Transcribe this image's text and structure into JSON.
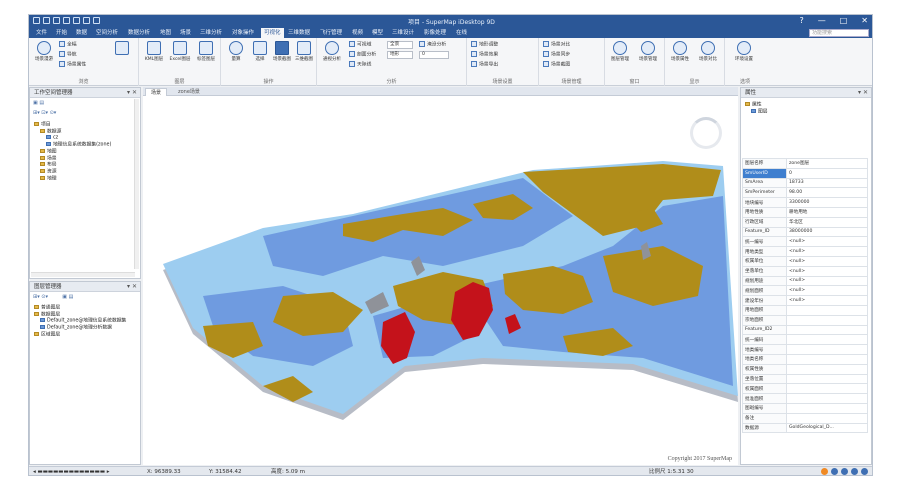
{
  "app": {
    "title": "项目 - SuperMap iDesktop 9D",
    "window_controls": [
      "?",
      "—",
      "□",
      "✕"
    ]
  },
  "menu": {
    "tabs": [
      "文件",
      "开始",
      "数据",
      "空间分析",
      "数据分析",
      "地图",
      "场景",
      "三维分析",
      "对象操作",
      "可视化",
      "三维数据",
      "飞行管理",
      "视频",
      "模型",
      "三维设计",
      "影像处理",
      "在线"
    ],
    "active_index": 9,
    "search_placeholder": "功能搜索"
  },
  "ribbon": {
    "groups": [
      {
        "label": "浏览",
        "buttons": [
          "场景漫游",
          "全幅",
          "导航",
          "场景属性"
        ]
      },
      {
        "label": "图层",
        "buttons": [
          "KML图层",
          "Excel图层",
          "标签图层",
          "专题图层"
        ]
      },
      {
        "label": "操作",
        "buttons": [
          "量算",
          "选择",
          "场景截图",
          "三维截图"
        ]
      },
      {
        "label": "分析",
        "buttons": [
          "通视分析",
          "可视域",
          "剖面分析",
          "天际线",
          "淹没分析"
        ]
      },
      {
        "label": "场景设置",
        "small": [
          "地形调整",
          "场景效果",
          "场景导出"
        ]
      },
      {
        "label": "场景管理",
        "small": [
          "场景对比",
          "场景同步",
          "场景截图"
        ]
      },
      {
        "label": "窗口",
        "buttons": [
          "图层管理",
          "场景管理"
        ]
      },
      {
        "label": "显示",
        "buttons": [
          "场景属性",
          "场景对比"
        ]
      },
      {
        "label": "选项",
        "buttons": [
          "环境设置"
        ]
      }
    ],
    "selects": [
      "全景",
      "地形",
      "0"
    ]
  },
  "workspace_panel": {
    "title": "工作空间管理器",
    "tree": [
      {
        "level": 0,
        "label": "项目",
        "kind": "folder"
      },
      {
        "level": 1,
        "label": "数据源",
        "kind": "folder"
      },
      {
        "level": 2,
        "label": "cz",
        "kind": "layer"
      },
      {
        "level": 2,
        "label": "地理信息系统数据集(zone)",
        "kind": "layer"
      },
      {
        "level": 1,
        "label": "地图",
        "kind": "folder"
      },
      {
        "level": 1,
        "label": "场景",
        "kind": "folder"
      },
      {
        "level": 1,
        "label": "布局",
        "kind": "folder"
      },
      {
        "level": 1,
        "label": "资源",
        "kind": "folder"
      },
      {
        "level": 1,
        "label": "地理",
        "kind": "folder"
      }
    ]
  },
  "layer_panel": {
    "title": "图层管理器",
    "tree": [
      {
        "level": 0,
        "label": "普通图层",
        "kind": "folder"
      },
      {
        "level": 0,
        "label": "数据图层",
        "kind": "folder"
      },
      {
        "level": 1,
        "label": "Default_zone@地理信息系统数据集",
        "kind": "layer"
      },
      {
        "level": 1,
        "label": "Default_zone@地理分析数据",
        "kind": "layer"
      },
      {
        "level": 0,
        "label": "区域图层",
        "kind": "folder"
      }
    ]
  },
  "document": {
    "tabs": [
      "场景",
      "zone场景"
    ],
    "active_index": 0
  },
  "map": {
    "copyright": "Copyright 2017 SuperMap",
    "colors": {
      "light_blue": "#9dcdf0",
      "blue": "#6f9be0",
      "gold": "#b08d1a",
      "red": "#c4121b",
      "gray": "#8f9299",
      "edge": "#b7bcc6"
    }
  },
  "properties_panel": {
    "title": "属性",
    "tree": [
      "属性",
      "图层"
    ],
    "rows": [
      {
        "key": "图层名称",
        "value": "zone图层"
      },
      {
        "key": "SmUserID",
        "value": "0"
      },
      {
        "key": "SmArea",
        "value": "18733"
      },
      {
        "key": "SmPerimeter",
        "value": "98.00"
      },
      {
        "key": "地块编号",
        "value": "3300000"
      },
      {
        "key": "用地性质",
        "value": "耕地用地"
      },
      {
        "key": "行政区域",
        "value": "华北区"
      },
      {
        "key": "Feature_ID",
        "value": "38000000"
      },
      {
        "key": "统一编号",
        "value": "<null>"
      },
      {
        "key": "用地类型",
        "value": "<null>"
      },
      {
        "key": "权属单位",
        "value": "<null>"
      },
      {
        "key": "坐落单位",
        "value": "<null>"
      },
      {
        "key": "规划用途",
        "value": "<null>"
      },
      {
        "key": "规划面积",
        "value": "<null>"
      },
      {
        "key": "建设年份",
        "value": "<null>"
      },
      {
        "key": "用地面积",
        "value": ""
      },
      {
        "key": "宗地面积",
        "value": ""
      },
      {
        "key": "Feature_ID2",
        "value": ""
      },
      {
        "key": "统一编码",
        "value": ""
      },
      {
        "key": "地类编号",
        "value": ""
      },
      {
        "key": "地类名称",
        "value": ""
      },
      {
        "key": "权属性质",
        "value": ""
      },
      {
        "key": "坐落位置",
        "value": ""
      },
      {
        "key": "权属面积",
        "value": ""
      },
      {
        "key": "批准面积",
        "value": ""
      },
      {
        "key": "图斑编号",
        "value": ""
      },
      {
        "key": "备注",
        "value": ""
      },
      {
        "key": "数据源",
        "value": "GoldGeological_D..."
      }
    ],
    "selected_index": 1
  },
  "status": {
    "x": "X: 96389.33",
    "y": "Y: 31584.42",
    "scale": "高度: 5.09 m",
    "map_scale": "比例尺 1:5.31 30"
  }
}
